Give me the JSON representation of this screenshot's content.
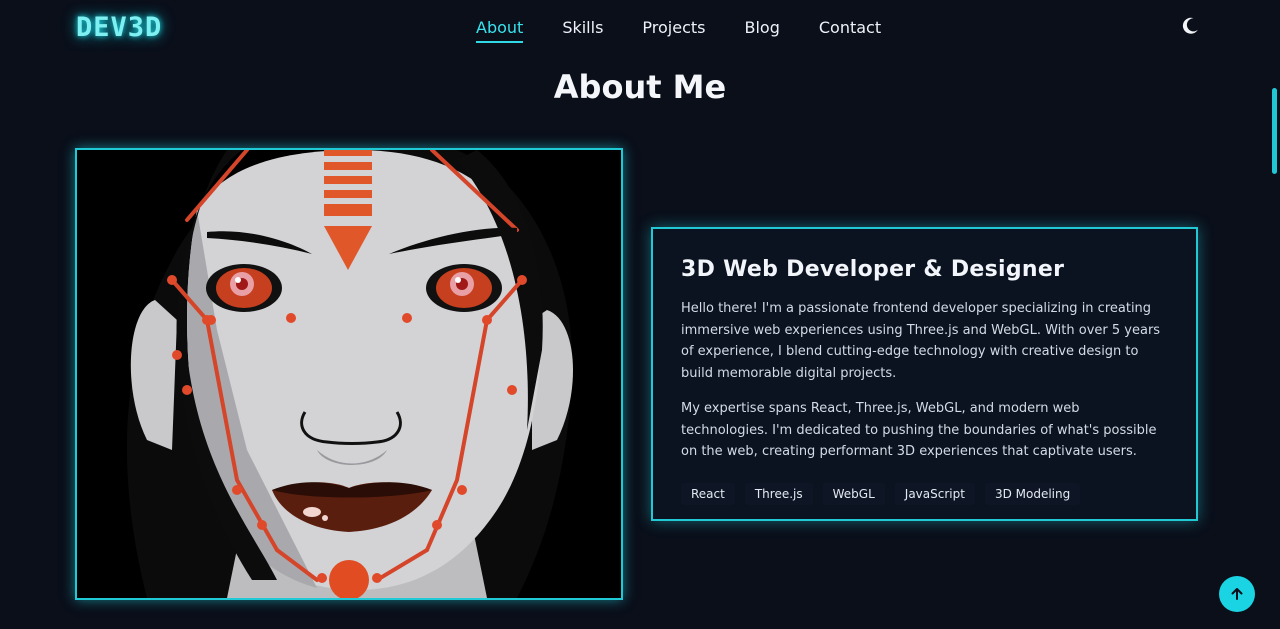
{
  "header": {
    "logo": "DEV3D",
    "nav": [
      {
        "label": "About",
        "active": true
      },
      {
        "label": "Skills",
        "active": false
      },
      {
        "label": "Projects",
        "active": false
      },
      {
        "label": "Blog",
        "active": false
      },
      {
        "label": "Contact",
        "active": false
      }
    ],
    "theme_icon": "moon-icon"
  },
  "section": {
    "title": "About Me"
  },
  "card": {
    "title": "3D Web Developer & Designer",
    "paragraphs": [
      "Hello there! I'm a passionate frontend developer specializing in creating immersive web experiences using Three.js and WebGL. With over 5 years of experience, I blend cutting-edge technology with creative design to build memorable digital projects.",
      "My expertise spans React, Three.js, WebGL, and modern web technologies. I'm dedicated to pushing the boundaries of what's possible on the web, creating performant 3D experiences that captivate users."
    ],
    "tags": [
      "React",
      "Three.js",
      "WebGL",
      "JavaScript",
      "3D Modeling"
    ]
  },
  "colors": {
    "accent": "#22c8d4",
    "background": "#0a0f1a",
    "card_bg": "#0b1220"
  },
  "icons": {
    "scroll_top": "arrow-up-icon"
  }
}
